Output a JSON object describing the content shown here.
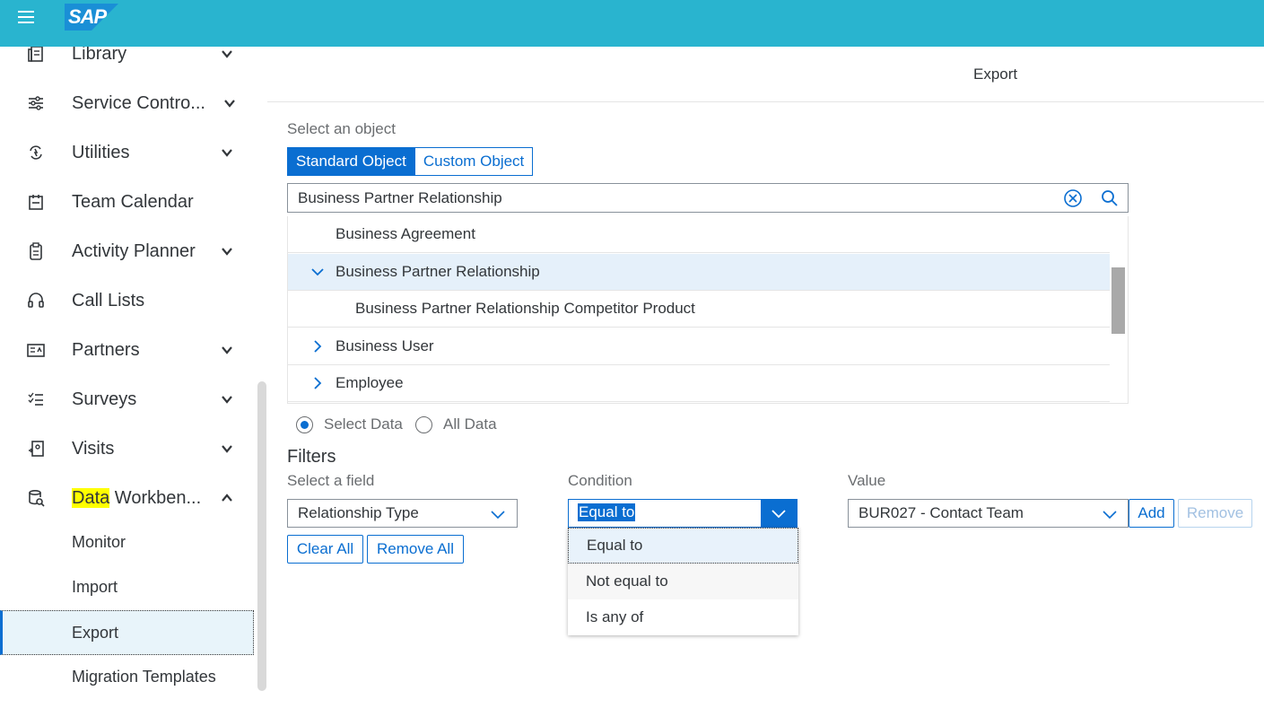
{
  "shell": {
    "logo": "SAP",
    "menu_icon": "hamburger-icon",
    "color": "#29b4cf"
  },
  "sidebar": {
    "items": [
      {
        "label": "Library",
        "icon": "library-icon",
        "expandable": true
      },
      {
        "label": "Service Contro...",
        "icon": "service-control-icon",
        "expandable": true
      },
      {
        "label": "Utilities",
        "icon": "utilities-icon",
        "expandable": true
      },
      {
        "label": "Team Calendar",
        "icon": "calendar-icon",
        "expandable": false
      },
      {
        "label": "Activity Planner",
        "icon": "activity-planner-icon",
        "expandable": true
      },
      {
        "label": "Call Lists",
        "icon": "headset-icon",
        "expandable": false
      },
      {
        "label": "Partners",
        "icon": "partners-icon",
        "expandable": true
      },
      {
        "label": "Surveys",
        "icon": "survey-icon",
        "expandable": true
      },
      {
        "label": "Visits",
        "icon": "visits-icon",
        "expandable": true
      },
      {
        "label_highlight": "Data",
        "label_rest": " Workben...",
        "icon": "data-workbench-icon",
        "expanded": true
      }
    ],
    "sub_items": [
      {
        "label": "Monitor"
      },
      {
        "label": "Import"
      },
      {
        "label": "Export",
        "selected": true
      },
      {
        "label": "Migration Templates"
      }
    ]
  },
  "page": {
    "title": "Export"
  },
  "object_select": {
    "label": "Select an object",
    "tabs": [
      "Standard Object",
      "Custom Object"
    ],
    "active_tab": "Standard Object",
    "search_value": "Business Partner Relationship"
  },
  "tree": {
    "rows": [
      {
        "label": "Business Agreement",
        "level": 1,
        "arrow": "none"
      },
      {
        "label": "Business Partner Relationship",
        "level": 1,
        "arrow": "down",
        "selected": true
      },
      {
        "label": "Business Partner Relationship Competitor Product",
        "level": 2,
        "arrow": "none"
      },
      {
        "label": "Business User",
        "level": 1,
        "arrow": "right"
      },
      {
        "label": "Employee",
        "level": 1,
        "arrow": "right"
      }
    ]
  },
  "data_mode": {
    "options": [
      "Select Data",
      "All Data"
    ],
    "selected": "Select Data"
  },
  "filters": {
    "title": "Filters",
    "field_label": "Select a field",
    "field_value": "Relationship Type",
    "condition_label": "Condition",
    "condition_value": "Equal to",
    "value_label": "Value",
    "value_value": "BUR027 - Contact Team",
    "add_label": "Add",
    "remove_label": "Remove",
    "clear_all_label": "Clear All",
    "remove_all_label": "Remove All",
    "condition_options": [
      "Equal to",
      "Not equal to",
      "Is any of"
    ]
  },
  "colors": {
    "accent": "#0a6ed1",
    "highlight": "#ffff00"
  }
}
